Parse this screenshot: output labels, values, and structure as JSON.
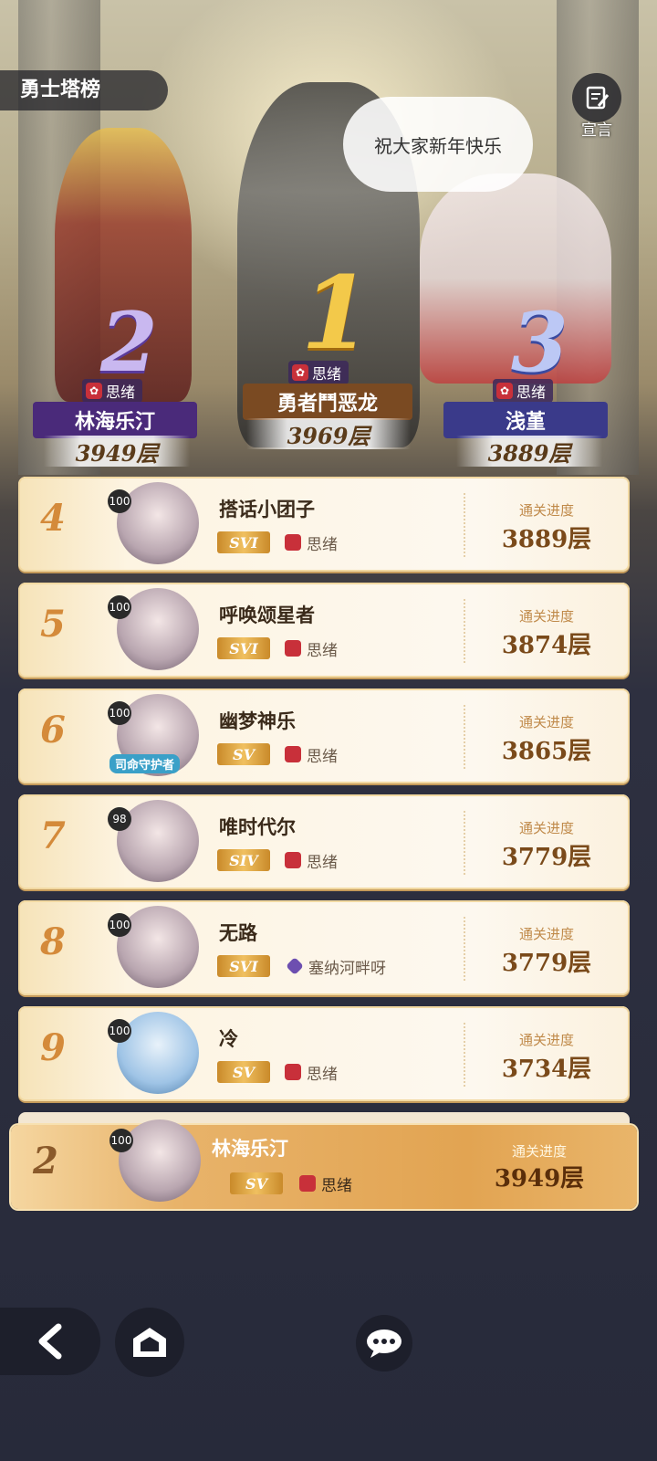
{
  "header": {
    "title": "勇士塔榜",
    "declare_label": "宣言"
  },
  "speech_bubble": "祝大家新年快乐",
  "podium": [
    {
      "rank": "1",
      "guild": "思绪",
      "name": "勇者鬥恶龙",
      "floors": "3969层",
      "plate_color": "#7a4a22"
    },
    {
      "rank": "2",
      "guild": "思绪",
      "name": "林海乐汀",
      "floors": "3949层",
      "plate_color": "#4a2a7a"
    },
    {
      "rank": "3",
      "guild": "思绪",
      "name": "浅堇",
      "floors": "3889层",
      "plate_color": "#3a3a8a"
    }
  ],
  "progress_label": "通关进度",
  "rankings": [
    {
      "rank": "4",
      "level": "100",
      "name": "搭话小团子",
      "vip": "SVI",
      "guild": "思绪",
      "floors": "3889层"
    },
    {
      "rank": "5",
      "level": "100",
      "name": "呼唤颂星者",
      "vip": "SVI",
      "guild": "思绪",
      "floors": "3874层"
    },
    {
      "rank": "6",
      "level": "100",
      "name": "幽梦神乐",
      "vip": "SV",
      "guild": "思绪",
      "floors": "3865层",
      "badge": "司命守护者"
    },
    {
      "rank": "7",
      "level": "98",
      "name": "唯时代尔",
      "vip": "SIV",
      "guild": "思绪",
      "floors": "3779层"
    },
    {
      "rank": "8",
      "level": "100",
      "name": "无路",
      "vip": "SVI",
      "guild": "塞纳河畔呀",
      "guild_icon": "牛",
      "floors": "3779层"
    },
    {
      "rank": "9",
      "level": "100",
      "name": "冷",
      "vip": "SV",
      "guild": "思绪",
      "floors": "3734层"
    }
  ],
  "self_row": {
    "rank": "2",
    "level": "100",
    "name": "林海乐汀",
    "vip": "SV",
    "guild": "思绪",
    "floors": "3949层"
  },
  "colors": {
    "accent": "#d48a3a",
    "row_bg": "#fdf4e2",
    "self_bg": "#e2a452",
    "page_bg": "#26293a"
  },
  "nav": {
    "back_icon": "back-arrow-icon",
    "home_icon": "home-icon",
    "chat_icon": "chat-icon"
  }
}
